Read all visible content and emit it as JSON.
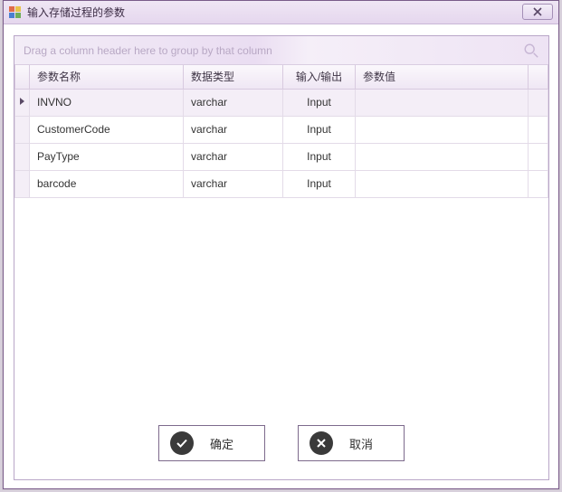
{
  "window": {
    "title": "输入存储过程的参数"
  },
  "groupStrip": {
    "hint": "Drag a column header here to group by that column"
  },
  "grid": {
    "columns": {
      "name": "参数名称",
      "type": "数据类型",
      "io": "输入/输出",
      "value": "参数值"
    },
    "rows": [
      {
        "name": "INVNO",
        "type": "varchar",
        "io": "Input",
        "value": "",
        "current": true
      },
      {
        "name": "CustomerCode",
        "type": "varchar",
        "io": "Input",
        "value": "",
        "current": false
      },
      {
        "name": "PayType",
        "type": "varchar",
        "io": "Input",
        "value": "",
        "current": false
      },
      {
        "name": "barcode",
        "type": "varchar",
        "io": "Input",
        "value": "",
        "current": false
      }
    ]
  },
  "footer": {
    "ok": "确定",
    "cancel": "取消"
  },
  "icons": {
    "close": "close-icon",
    "search": "search-icon",
    "ok": "check-circle-icon",
    "cancel": "x-circle-icon"
  }
}
